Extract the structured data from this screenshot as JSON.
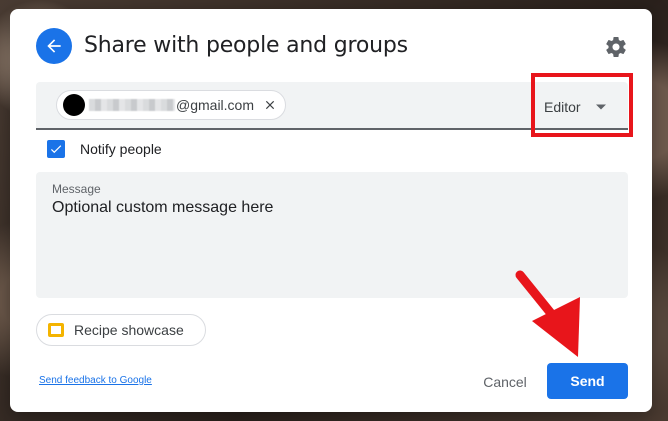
{
  "dialog": {
    "title": "Share with people and groups",
    "icons": {
      "back": "arrow-back-icon",
      "settings": "gear-icon"
    }
  },
  "recipient": {
    "email_visible": "@gmail.com",
    "avatar_icon": "avatar",
    "remove_icon": "close-icon"
  },
  "role": {
    "selected": "Editor",
    "caret_icon": "caret-down-icon"
  },
  "notify": {
    "label": "Notify people",
    "checked": true
  },
  "message": {
    "label": "Message",
    "placeholder": "Optional custom message here"
  },
  "attachment": {
    "label": "Recipe showcase",
    "icon": "google-slides-icon"
  },
  "footer": {
    "feedback_link": "Send feedback to Google",
    "cancel_label": "Cancel",
    "send_label": "Send"
  },
  "annotations": {
    "highlight_color": "#e8151b",
    "arrow_color": "#e8151b"
  },
  "colors": {
    "accent": "#1a73e8",
    "field_bg": "#f1f3f4"
  }
}
